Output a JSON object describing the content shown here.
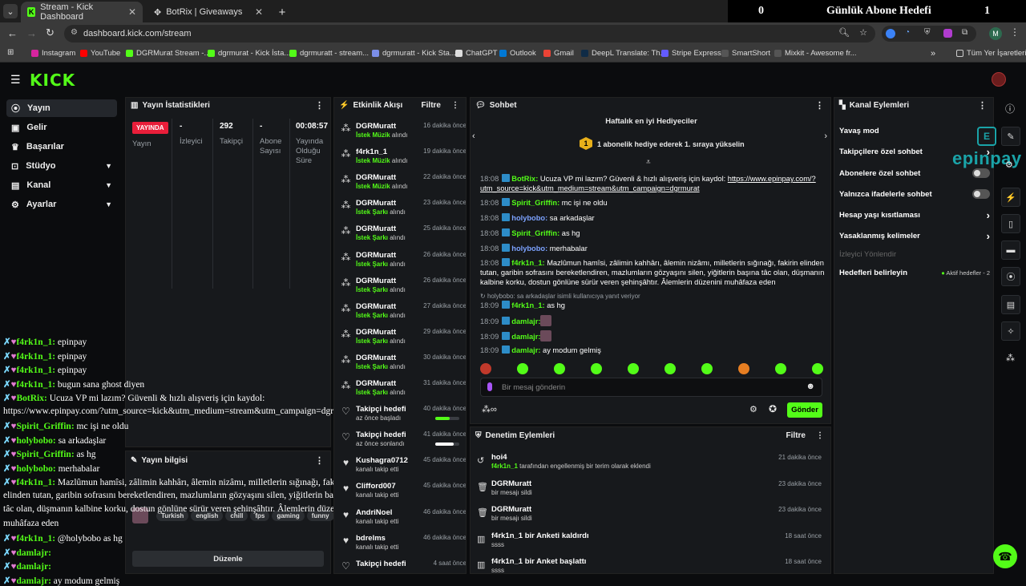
{
  "browser": {
    "tabs": [
      {
        "title": "Stream - Kick Dashboard"
      },
      {
        "title": "BotRix | Giveaways"
      }
    ],
    "url": "dashboard.kick.com/stream",
    "bookmarks": [
      "Instagram",
      "YouTube",
      "DGRMurat Stream -...",
      "dgrmurat - Kick İsta...",
      "dgrmuratt - stream...",
      "dgrmuratt - Kick Sta...",
      "ChatGPT",
      "Outlook",
      "Gmail",
      "DeepL Translate: Th...",
      "Stripe Express",
      "SmartShort",
      "Mixkit - Awesome fr...",
      "Tüm Yer İşaretleri"
    ],
    "profile_initial": "M"
  },
  "goal": {
    "left": "0",
    "title": "Günlük Abone Hedefi",
    "right": "1"
  },
  "sidebar": {
    "items": [
      {
        "label": "Yayın",
        "icon": "broadcast-icon"
      },
      {
        "label": "Gelir",
        "icon": "wallet-icon"
      },
      {
        "label": "Başarılar",
        "icon": "trophy-icon"
      },
      {
        "label": "Stüdyo",
        "icon": "studio-icon"
      },
      {
        "label": "Kanal",
        "icon": "channel-icon"
      },
      {
        "label": "Ayarlar",
        "icon": "gear-icon"
      }
    ]
  },
  "stats": {
    "title": "Yayın İstatistikleri",
    "cols": [
      {
        "value": "YAYINDA",
        "label": "Yayın"
      },
      {
        "value": "-",
        "label": "İzleyici"
      },
      {
        "value": "292",
        "label": "Takipçi"
      },
      {
        "value": "-",
        "label": "Abone Sayısı"
      },
      {
        "value": "00:08:57",
        "label": "Yayında Olduğu Süre"
      }
    ]
  },
  "stream_info": {
    "title": "Yayın bilgisi",
    "tags": [
      "Turkish",
      "english",
      "chill",
      "fps",
      "gaming",
      "funny"
    ],
    "edit_label": "Düzenle"
  },
  "overlay_chat": [
    {
      "user": "f4rk1n_1:",
      "text": " epinpay"
    },
    {
      "user": "f4rk1n_1:",
      "text": " epinpay"
    },
    {
      "user": "f4rk1n_1:",
      "text": " epinpay"
    },
    {
      "user": "f4rk1n_1:",
      "text": " bugun sana ghost diyen"
    },
    {
      "user": "BotRix:",
      "text": " Ucuza VP mi lazım? Güvenli & hızlı alışveriş için kaydol:"
    },
    {
      "user": "",
      "text": "https://www.epinpay.com/?utm_source=kick&utm_medium=stream&utm_campaign=dgrmurat"
    },
    {
      "user": "Spirit_Griffin:",
      "text": " mc işi ne oldu"
    },
    {
      "user": "holybobo:",
      "text": " sa arkadaşlar"
    },
    {
      "user": "Spirit_Griffin:",
      "text": " as hg"
    },
    {
      "user": "holybobo:",
      "text": " merhabalar"
    },
    {
      "user": "f4rk1n_1:",
      "text": " Mazlûmun hamîsi, zâlimin kahhârı, âlemin nizâmı, milletlerin sığınağı, fakirin"
    },
    {
      "user": "",
      "text": "elinden tutan, garibin sofrasını bereketlendiren, mazlumların gözyaşını silen, yiğitlerin başına"
    },
    {
      "user": "",
      "text": "tâc olan, düşmanın kalbine korku, dostun gönlüne sürür veren şehinşâhtır. Âlemlerin düzenini"
    },
    {
      "user": "",
      "text": "muhâfaza eden"
    },
    {
      "user": "f4rk1n_1:",
      "text": " @holybobo as hg"
    },
    {
      "user": "damlajr:",
      "text": ""
    },
    {
      "user": "damlajr:",
      "text": ""
    },
    {
      "user": "damlajr:",
      "text": " ay modum gelmiş"
    }
  ],
  "activity": {
    "title": "Etkinlik Akışı",
    "filter": "Filtre",
    "items": [
      {
        "name": "DGRMuratt",
        "a": "İstek Müzik",
        "b": "alındı",
        "time": "16 dakika önce",
        "icon": "share-icon"
      },
      {
        "name": "f4rk1n_1",
        "a": "İstek Müzik",
        "b": "alındı",
        "time": "19 dakika önce",
        "icon": "share-icon"
      },
      {
        "name": "DGRMuratt",
        "a": "İstek Müzik",
        "b": "alındı",
        "time": "22 dakika önce",
        "icon": "share-icon"
      },
      {
        "name": "DGRMuratt",
        "a": "İstek Şarkı",
        "b": "alındı",
        "time": "23 dakika önce",
        "icon": "share-icon"
      },
      {
        "name": "DGRMuratt",
        "a": "İstek Şarkı",
        "b": "alındı",
        "time": "25 dakika önce",
        "icon": "share-icon"
      },
      {
        "name": "DGRMuratt",
        "a": "İstek Şarkı",
        "b": "alındı",
        "time": "26 dakika önce",
        "icon": "share-icon"
      },
      {
        "name": "DGRMuratt",
        "a": "İstek Şarkı",
        "b": "alındı",
        "time": "26 dakika önce",
        "icon": "share-icon"
      },
      {
        "name": "DGRMuratt",
        "a": "İstek Şarkı",
        "b": "alındı",
        "time": "27 dakika önce",
        "icon": "share-icon"
      },
      {
        "name": "DGRMuratt",
        "a": "İstek Şarkı",
        "b": "alındı",
        "time": "29 dakika önce",
        "icon": "share-icon"
      },
      {
        "name": "DGRMuratt",
        "a": "İstek Şarkı",
        "b": "alındı",
        "time": "30 dakika önce",
        "icon": "share-icon"
      },
      {
        "name": "DGRMuratt",
        "a": "İstek Şarkı",
        "b": "alındı",
        "time": "31 dakika önce",
        "icon": "share-icon"
      },
      {
        "name": "Takipçi hedefi",
        "a": "",
        "b": "az önce başladı",
        "time": "40 dakika önce",
        "icon": "heart-outline-icon",
        "progress": 0.6,
        "color": "#53fc18"
      },
      {
        "name": "Takipçi hedefi",
        "a": "",
        "b": "az önce sonlandı",
        "time": "41 dakika önce",
        "icon": "heart-outline-icon",
        "progress": 0.75,
        "color": "#ffffff"
      },
      {
        "name": "Kushagra0712",
        "a": "",
        "b": "kanalı takip etti",
        "time": "45 dakika önce",
        "icon": "heart-icon"
      },
      {
        "name": "Clifford007",
        "a": "",
        "b": "kanalı takip etti",
        "time": "45 dakika önce",
        "icon": "heart-icon"
      },
      {
        "name": "AndriNoel",
        "a": "",
        "b": "kanalı takip etti",
        "time": "46 dakika önce",
        "icon": "heart-icon"
      },
      {
        "name": "bdrelms",
        "a": "",
        "b": "kanalı takip etti",
        "time": "46 dakika önce",
        "icon": "heart-icon"
      },
      {
        "name": "Takipçi hedefi",
        "a": "",
        "b": "",
        "time": "4 saat önce",
        "icon": "heart-outline-icon"
      }
    ]
  },
  "chat": {
    "title": "Sohbet",
    "leaderboard_title": "Haftalık en iyi Hediyeciler",
    "leaderboard_rank": "1",
    "leaderboard_text": "1 abonelik hediye ederek 1. sıraya yükselin",
    "messages": [
      {
        "time": "18:08",
        "user": "BotRix:",
        "text": " Ucuza VP mi lazım? Güvenli & hızlı alışveriş için kaydol: ",
        "link": "https://www.epinpay.com/?utm_source=kick&utm_medium=stream&utm_campaign=dgrmurat"
      },
      {
        "time": "18:08",
        "user": "Spirit_Griffin:",
        "text": " mc işi ne oldu"
      },
      {
        "time": "18:08",
        "user": "holybobo:",
        "text": " sa arkadaşlar"
      },
      {
        "time": "18:08",
        "user": "Spirit_Griffin:",
        "text": " as hg"
      },
      {
        "time": "18:08",
        "user": "holybobo:",
        "text": " merhabalar"
      },
      {
        "time": "18:08",
        "user": "f4rk1n_1:",
        "text": " Mazlûmun hamîsi, zâlimin kahhârı, âlemin nizâmı, milletlerin sığınağı, fakirin elinden tutan, garibin sofrasını bereketlendiren, mazlumların gözyaşını silen, yiğitlerin başına tâc olan, düşmanın kalbine korku, dostun gönlüne sürür veren şehinşâhtır. Âlemlerin düzenini muhâfaza eden"
      },
      {
        "time": "",
        "user": "",
        "text": "holybobo: sa arkadaşlar isimli kullanıcıya yanıt veriyor"
      },
      {
        "time": "18:09",
        "user": "f4rk1n_1:",
        "text": " as hg"
      },
      {
        "time": "18:09",
        "user": "damlajr:",
        "text": ""
      },
      {
        "time": "18:09",
        "user": "damlajr:",
        "text": ""
      },
      {
        "time": "18:09",
        "user": "damlajr:",
        "text": " ay modum gelmiş"
      }
    ],
    "input_placeholder": "Bir mesaj gönderin",
    "send_label": "Gönder"
  },
  "moderation": {
    "title": "Denetim Eylemleri",
    "filter": "Filtre",
    "items": [
      {
        "name": "hoi4",
        "sub_user": "f4rk1n_1",
        "sub": " tarafından engellenmiş bir terim olarak eklendi",
        "time": "21 dakika önce",
        "icon": "undo-icon"
      },
      {
        "name": "DGRMuratt",
        "sub_user": "",
        "sub": "bir mesajı sildi",
        "time": "23 dakika önce",
        "icon": "trash-icon"
      },
      {
        "name": "DGRMuratt",
        "sub_user": "",
        "sub": "bir mesajı sildi",
        "time": "23 dakika önce",
        "icon": "trash-icon"
      },
      {
        "name": "f4rk1n_1 bir Anketi kaldırdı",
        "sub_user": "",
        "sub": "ssss",
        "time": "18 saat önce",
        "icon": "poll-icon"
      },
      {
        "name": "f4rk1n_1 bir Anket başlattı",
        "sub_user": "",
        "sub": "ssss",
        "time": "18 saat önce",
        "icon": "poll-icon"
      }
    ]
  },
  "channel_actions": {
    "title": "Kanal Eylemleri",
    "items": [
      {
        "label": "Yavaş mod",
        "kind": "none"
      },
      {
        "label": "Takipçilere özel sohbet",
        "kind": "chevron"
      },
      {
        "label": "Abonelere özel sohbet",
        "kind": "toggle"
      },
      {
        "label": "Yalnızca ifadelerle sohbet",
        "kind": "toggle"
      },
      {
        "label": "Hesap yaşı kısıtlaması",
        "kind": "chevron"
      },
      {
        "label": "Yasaklanmış kelimeler",
        "kind": "chevron"
      },
      {
        "label": "İzleyici Yönlendir",
        "kind": "disabled"
      },
      {
        "label": "Hedefleri belirleyin",
        "kind": "status",
        "status": "Aktif hedefler - 2"
      }
    ]
  },
  "watermark": "epinpay",
  "colors": {
    "accent": "#53fc18",
    "live": "#e91e3a",
    "panel": "#17191c",
    "bg": "#0b0c0e"
  }
}
